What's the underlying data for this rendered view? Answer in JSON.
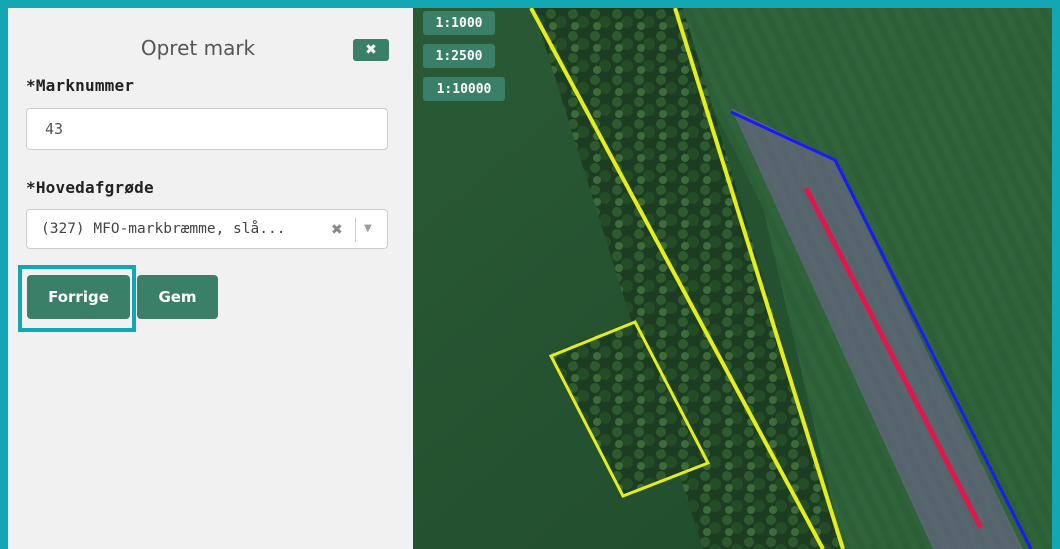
{
  "panel": {
    "title": "Opret mark",
    "close_label": "✖"
  },
  "form": {
    "field_number": {
      "label": "*Marknummer",
      "value": "43"
    },
    "crop": {
      "label": "*Hovedafgrøde",
      "selected": "(327) MFO-markbræmme, slå...",
      "clear": "✖",
      "arrow": "▼"
    }
  },
  "buttons": {
    "previous": "Forrige",
    "save": "Gem"
  },
  "map": {
    "scales": [
      "1:1000",
      "1:2500",
      "1:10000"
    ],
    "colors": {
      "yellow_outline": "#e5ee19",
      "blue_outline": "#1a1aff",
      "red_line": "#e0174a"
    }
  }
}
